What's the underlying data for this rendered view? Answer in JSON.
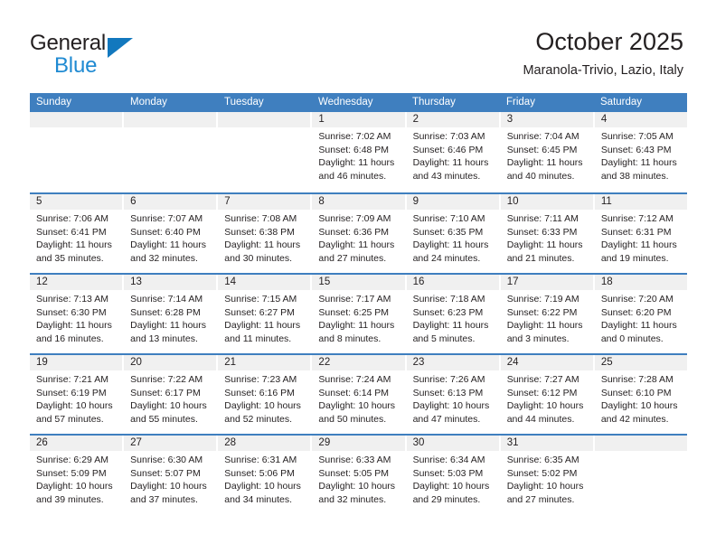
{
  "logo": {
    "word_one": "General",
    "word_two": "Blue",
    "triangle_icon": "triangle-icon",
    "brand_dark": "#231f20",
    "brand_blue": "#1f8ad2",
    "triangle_blue": "#1278be"
  },
  "header": {
    "title": "October 2025",
    "subtitle": "Maranola-Trivio, Lazio, Italy"
  },
  "theme": {
    "header_row_bg": "#3f7fbf",
    "day_number_bg": "#f0f0f0",
    "text": "#231f20"
  },
  "calendar": {
    "weekdays": [
      "Sunday",
      "Monday",
      "Tuesday",
      "Wednesday",
      "Thursday",
      "Friday",
      "Saturday"
    ],
    "weeks": [
      [
        {
          "day": "",
          "sunrise": "",
          "sunset": "",
          "daylight_line1": "",
          "daylight_line2": "",
          "empty": true
        },
        {
          "day": "",
          "sunrise": "",
          "sunset": "",
          "daylight_line1": "",
          "daylight_line2": "",
          "empty": true
        },
        {
          "day": "",
          "sunrise": "",
          "sunset": "",
          "daylight_line1": "",
          "daylight_line2": "",
          "empty": true
        },
        {
          "day": "1",
          "sunrise": "Sunrise: 7:02 AM",
          "sunset": "Sunset: 6:48 PM",
          "daylight_line1": "Daylight: 11 hours",
          "daylight_line2": "and 46 minutes."
        },
        {
          "day": "2",
          "sunrise": "Sunrise: 7:03 AM",
          "sunset": "Sunset: 6:46 PM",
          "daylight_line1": "Daylight: 11 hours",
          "daylight_line2": "and 43 minutes."
        },
        {
          "day": "3",
          "sunrise": "Sunrise: 7:04 AM",
          "sunset": "Sunset: 6:45 PM",
          "daylight_line1": "Daylight: 11 hours",
          "daylight_line2": "and 40 minutes."
        },
        {
          "day": "4",
          "sunrise": "Sunrise: 7:05 AM",
          "sunset": "Sunset: 6:43 PM",
          "daylight_line1": "Daylight: 11 hours",
          "daylight_line2": "and 38 minutes."
        }
      ],
      [
        {
          "day": "5",
          "sunrise": "Sunrise: 7:06 AM",
          "sunset": "Sunset: 6:41 PM",
          "daylight_line1": "Daylight: 11 hours",
          "daylight_line2": "and 35 minutes."
        },
        {
          "day": "6",
          "sunrise": "Sunrise: 7:07 AM",
          "sunset": "Sunset: 6:40 PM",
          "daylight_line1": "Daylight: 11 hours",
          "daylight_line2": "and 32 minutes."
        },
        {
          "day": "7",
          "sunrise": "Sunrise: 7:08 AM",
          "sunset": "Sunset: 6:38 PM",
          "daylight_line1": "Daylight: 11 hours",
          "daylight_line2": "and 30 minutes."
        },
        {
          "day": "8",
          "sunrise": "Sunrise: 7:09 AM",
          "sunset": "Sunset: 6:36 PM",
          "daylight_line1": "Daylight: 11 hours",
          "daylight_line2": "and 27 minutes."
        },
        {
          "day": "9",
          "sunrise": "Sunrise: 7:10 AM",
          "sunset": "Sunset: 6:35 PM",
          "daylight_line1": "Daylight: 11 hours",
          "daylight_line2": "and 24 minutes."
        },
        {
          "day": "10",
          "sunrise": "Sunrise: 7:11 AM",
          "sunset": "Sunset: 6:33 PM",
          "daylight_line1": "Daylight: 11 hours",
          "daylight_line2": "and 21 minutes."
        },
        {
          "day": "11",
          "sunrise": "Sunrise: 7:12 AM",
          "sunset": "Sunset: 6:31 PM",
          "daylight_line1": "Daylight: 11 hours",
          "daylight_line2": "and 19 minutes."
        }
      ],
      [
        {
          "day": "12",
          "sunrise": "Sunrise: 7:13 AM",
          "sunset": "Sunset: 6:30 PM",
          "daylight_line1": "Daylight: 11 hours",
          "daylight_line2": "and 16 minutes."
        },
        {
          "day": "13",
          "sunrise": "Sunrise: 7:14 AM",
          "sunset": "Sunset: 6:28 PM",
          "daylight_line1": "Daylight: 11 hours",
          "daylight_line2": "and 13 minutes."
        },
        {
          "day": "14",
          "sunrise": "Sunrise: 7:15 AM",
          "sunset": "Sunset: 6:27 PM",
          "daylight_line1": "Daylight: 11 hours",
          "daylight_line2": "and 11 minutes."
        },
        {
          "day": "15",
          "sunrise": "Sunrise: 7:17 AM",
          "sunset": "Sunset: 6:25 PM",
          "daylight_line1": "Daylight: 11 hours",
          "daylight_line2": "and 8 minutes."
        },
        {
          "day": "16",
          "sunrise": "Sunrise: 7:18 AM",
          "sunset": "Sunset: 6:23 PM",
          "daylight_line1": "Daylight: 11 hours",
          "daylight_line2": "and 5 minutes."
        },
        {
          "day": "17",
          "sunrise": "Sunrise: 7:19 AM",
          "sunset": "Sunset: 6:22 PM",
          "daylight_line1": "Daylight: 11 hours",
          "daylight_line2": "and 3 minutes."
        },
        {
          "day": "18",
          "sunrise": "Sunrise: 7:20 AM",
          "sunset": "Sunset: 6:20 PM",
          "daylight_line1": "Daylight: 11 hours",
          "daylight_line2": "and 0 minutes."
        }
      ],
      [
        {
          "day": "19",
          "sunrise": "Sunrise: 7:21 AM",
          "sunset": "Sunset: 6:19 PM",
          "daylight_line1": "Daylight: 10 hours",
          "daylight_line2": "and 57 minutes."
        },
        {
          "day": "20",
          "sunrise": "Sunrise: 7:22 AM",
          "sunset": "Sunset: 6:17 PM",
          "daylight_line1": "Daylight: 10 hours",
          "daylight_line2": "and 55 minutes."
        },
        {
          "day": "21",
          "sunrise": "Sunrise: 7:23 AM",
          "sunset": "Sunset: 6:16 PM",
          "daylight_line1": "Daylight: 10 hours",
          "daylight_line2": "and 52 minutes."
        },
        {
          "day": "22",
          "sunrise": "Sunrise: 7:24 AM",
          "sunset": "Sunset: 6:14 PM",
          "daylight_line1": "Daylight: 10 hours",
          "daylight_line2": "and 50 minutes."
        },
        {
          "day": "23",
          "sunrise": "Sunrise: 7:26 AM",
          "sunset": "Sunset: 6:13 PM",
          "daylight_line1": "Daylight: 10 hours",
          "daylight_line2": "and 47 minutes."
        },
        {
          "day": "24",
          "sunrise": "Sunrise: 7:27 AM",
          "sunset": "Sunset: 6:12 PM",
          "daylight_line1": "Daylight: 10 hours",
          "daylight_line2": "and 44 minutes."
        },
        {
          "day": "25",
          "sunrise": "Sunrise: 7:28 AM",
          "sunset": "Sunset: 6:10 PM",
          "daylight_line1": "Daylight: 10 hours",
          "daylight_line2": "and 42 minutes."
        }
      ],
      [
        {
          "day": "26",
          "sunrise": "Sunrise: 6:29 AM",
          "sunset": "Sunset: 5:09 PM",
          "daylight_line1": "Daylight: 10 hours",
          "daylight_line2": "and 39 minutes."
        },
        {
          "day": "27",
          "sunrise": "Sunrise: 6:30 AM",
          "sunset": "Sunset: 5:07 PM",
          "daylight_line1": "Daylight: 10 hours",
          "daylight_line2": "and 37 minutes."
        },
        {
          "day": "28",
          "sunrise": "Sunrise: 6:31 AM",
          "sunset": "Sunset: 5:06 PM",
          "daylight_line1": "Daylight: 10 hours",
          "daylight_line2": "and 34 minutes."
        },
        {
          "day": "29",
          "sunrise": "Sunrise: 6:33 AM",
          "sunset": "Sunset: 5:05 PM",
          "daylight_line1": "Daylight: 10 hours",
          "daylight_line2": "and 32 minutes."
        },
        {
          "day": "30",
          "sunrise": "Sunrise: 6:34 AM",
          "sunset": "Sunset: 5:03 PM",
          "daylight_line1": "Daylight: 10 hours",
          "daylight_line2": "and 29 minutes."
        },
        {
          "day": "31",
          "sunrise": "Sunrise: 6:35 AM",
          "sunset": "Sunset: 5:02 PM",
          "daylight_line1": "Daylight: 10 hours",
          "daylight_line2": "and 27 minutes."
        },
        {
          "day": "",
          "sunrise": "",
          "sunset": "",
          "daylight_line1": "",
          "daylight_line2": "",
          "empty": true
        }
      ]
    ]
  }
}
